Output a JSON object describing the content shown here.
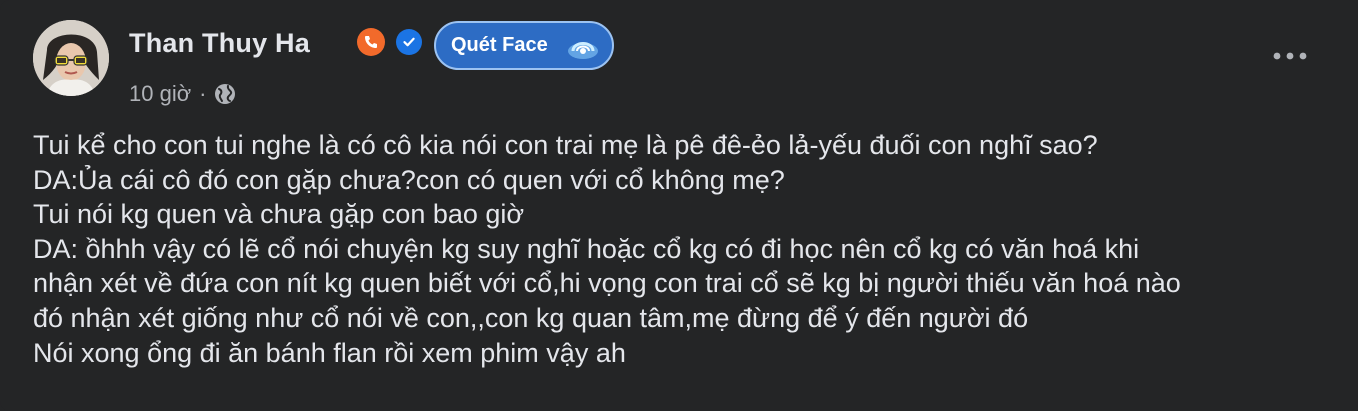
{
  "post": {
    "author": "Than Thuy Ha",
    "scan_button_label": "Quét Face",
    "time": "10 giờ",
    "separator": "·",
    "privacy_icon": "globe-icon",
    "badges": [
      "phone-icon",
      "verified-icon"
    ],
    "more_icon": "more-horizontal-icon",
    "lines": [
      "Tui kể cho con tui nghe là có cô kia nói con trai mẹ là pê đê-ẻo lả-yếu đuối con nghĩ sao?",
      "DA:Ủa cái cô đó con gặp chưa?con có quen với cổ không mẹ?",
      "Tui nói kg quen và chưa gặp con bao giờ",
      "DA: ồhhh vậy có lẽ cổ nói chuyện kg suy nghĩ hoặc cổ kg có đi học nên cổ kg có văn hoá khi",
      "nhận xét về đứa con nít kg quen biết với cổ,hi vọng con trai cổ sẽ kg bị người thiếu văn hoá nào",
      "đó nhận xét giống như cổ nói về con,,con kg quan tâm,mẹ đừng để ý đến người đó",
      "Nói xong ổng đi ăn bánh flan rồi xem phim vậy ah"
    ]
  },
  "colors": {
    "background": "#242526",
    "text": "#e4e6eb",
    "secondary_text": "#b0b3b8",
    "verified": "#1b74e4",
    "phone_badge": "#f26a2b",
    "scan_button": "#2d6cc4"
  }
}
